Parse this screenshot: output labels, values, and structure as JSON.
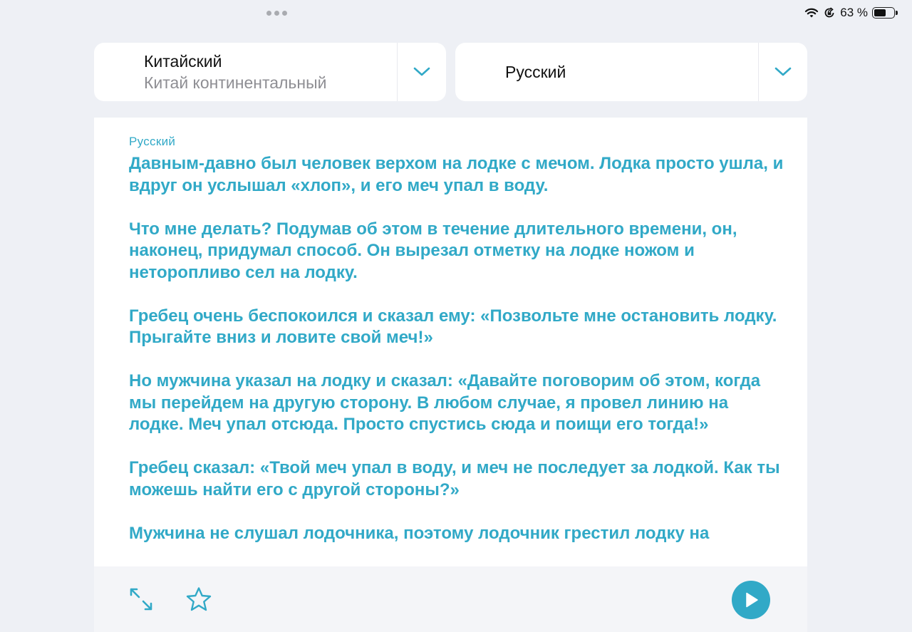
{
  "status_bar": {
    "battery_percent": "63 %",
    "battery_level": 0.63,
    "icons": [
      "wifi-icon",
      "orientation-lock-icon",
      "battery-icon"
    ]
  },
  "source_language": {
    "name": "Китайский",
    "variant": "Китай континентальный"
  },
  "target_language": {
    "name": "Русский"
  },
  "translation": {
    "language_label": "Русский",
    "paragraphs": [
      "Давным-давно был человек верхом на лодке с мечом. Лодка просто ушла, и вдруг он услышал «хлоп», и его меч упал в воду.",
      "Что мне делать? Подумав об этом в течение длительного времени, он, наконец, придумал способ. Он вырезал отметку на лодке ножом и неторопливо сел на лодку.",
      "Гребец очень беспокоился и сказал ему: «Позвольте мне остановить лодку. Прыгайте вниз и ловите свой меч!»",
      "Но мужчина указал на лодку и сказал: «Давайте поговорим об этом, когда мы перейдем на другую сторону. В любом случае, я провел линию на лодке. Меч упал отсюда. Просто спустись сюда и поищи его тогда!»",
      "Гребец сказал: «Твой меч упал в воду, и меч не последует за лодкой. Как ты можешь найти его с другой стороны?»",
      "Мужчина не слушал лодочника, поэтому лодочник грестил лодку на"
    ]
  },
  "toolbar": {
    "icons": [
      "expand-icon",
      "star-icon",
      "play-icon"
    ]
  },
  "colors": {
    "accent": "#31a9c7",
    "background": "#eef0f5",
    "card": "#ffffff",
    "secondary_text": "#8e8e93"
  }
}
